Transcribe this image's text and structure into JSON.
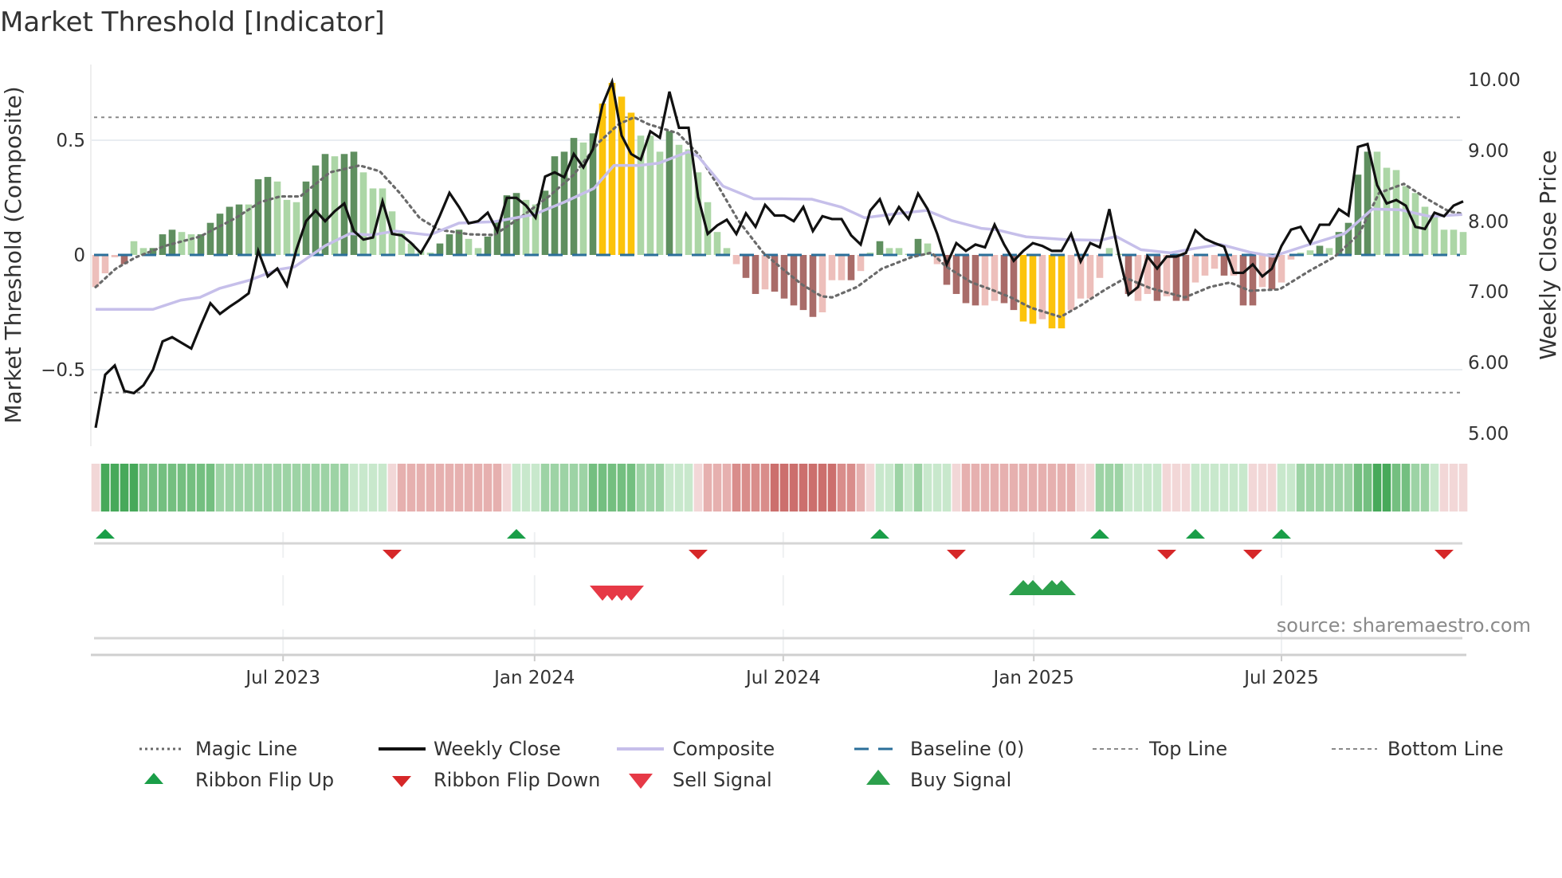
{
  "chart_data": {
    "type": "bar",
    "title": "Market Threshold [Indicator]",
    "ylabel": "Market Threshold (Composite)",
    "ylabel_right": "Weekly Close Price",
    "ylim": [
      -0.83,
      0.83
    ],
    "ylim_right": [
      4.6,
      10.2
    ],
    "yticks": [
      {
        "v": 0.5,
        "label": "0.5"
      },
      {
        "v": 0,
        "label": "0"
      },
      {
        "v": -0.5,
        "label": "−0.5"
      }
    ],
    "yticks_right": [
      {
        "v": 10,
        "label": "10.00"
      },
      {
        "v": 9,
        "label": "9.00"
      },
      {
        "v": 8,
        "label": "8.00"
      },
      {
        "v": 7,
        "label": "7.00"
      },
      {
        "v": 6,
        "label": "6.00"
      },
      {
        "v": 5,
        "label": "5.00"
      }
    ],
    "x_unit": "week index (weekly, ~Feb 2023 to Nov 2025)",
    "xticks": [
      {
        "week": 19.6,
        "label": "Jul 2023"
      },
      {
        "week": 45.9,
        "label": "Jan 2024"
      },
      {
        "week": 71.9,
        "label": "Jul 2024"
      },
      {
        "week": 98.1,
        "label": "Jan 2025"
      },
      {
        "week": 124.0,
        "label": "Jul 2025"
      }
    ],
    "top_line": 0.6,
    "bottom_line": -0.6,
    "baseline": 0,
    "grid": true,
    "legend_placement": "bottom",
    "source": "source: sharemaestro.com",
    "bar_values": [
      -0.14,
      -0.08,
      -0.01,
      -0.04,
      0.06,
      0.03,
      0.03,
      0.09,
      0.11,
      0.1,
      0.09,
      0.09,
      0.14,
      0.18,
      0.21,
      0.22,
      0.22,
      0.33,
      0.34,
      0.32,
      0.24,
      0.23,
      0.32,
      0.39,
      0.44,
      0.43,
      0.44,
      0.45,
      0.36,
      0.29,
      0.29,
      0.19,
      0.1,
      0.05,
      0.02,
      0.01,
      0.05,
      0.09,
      0.11,
      0.07,
      0.03,
      0.08,
      0.15,
      0.26,
      0.27,
      0.24,
      0.22,
      0.28,
      0.43,
      0.45,
      0.51,
      0.49,
      0.53,
      0.66,
      0.75,
      0.69,
      0.62,
      0.52,
      0.52,
      0.45,
      0.54,
      0.48,
      0.46,
      0.36,
      0.23,
      0.1,
      0.03,
      -0.04,
      -0.1,
      -0.17,
      -0.15,
      -0.16,
      -0.19,
      -0.22,
      -0.24,
      -0.27,
      -0.25,
      -0.11,
      -0.11,
      -0.11,
      -0.07,
      0.01,
      0.06,
      0.03,
      0.03,
      0.005,
      0.07,
      0.05,
      -0.04,
      -0.13,
      -0.17,
      -0.21,
      -0.22,
      -0.22,
      -0.2,
      -0.21,
      -0.24,
      -0.29,
      -0.3,
      -0.28,
      -0.32,
      -0.32,
      -0.24,
      -0.19,
      -0.19,
      -0.1,
      0.03,
      0.005,
      -0.17,
      -0.2,
      -0.17,
      -0.2,
      -0.18,
      -0.2,
      -0.2,
      -0.12,
      -0.09,
      -0.06,
      -0.09,
      -0.09,
      -0.22,
      -0.22,
      -0.14,
      -0.15,
      -0.12,
      -0.02,
      0.01,
      0.02,
      0.04,
      0.03,
      0.1,
      0.14,
      0.35,
      0.45,
      0.45,
      0.38,
      0.37,
      0.3,
      0.27,
      0.21,
      0.17,
      0.11,
      0.11,
      0.1
    ],
    "bar_classes": "PPPBLLDDDLLDDDDDLDDLLLDDDLDDLLLLLLLLDDDLLDDDDLLDDDDLDYYYYLLLDLLLLLLPBBPBBBBBPPPBPLDLLLDLPBBBBPPBBYYPYYPPPPLLBPPBPBBPPPBPBBPBPPLLDLDDDDLLLLLLLLLL",
    "bar_class_colors": {
      "D": "#5f8f5f",
      "L": "#acd6a6",
      "Y": "#fcc30b",
      "B": "#a96c69",
      "P": "#edbfbb"
    },
    "weekly_close": [
      5.08,
      5.83,
      5.96,
      5.6,
      5.57,
      5.68,
      5.9,
      6.3,
      6.36,
      6.28,
      6.2,
      6.53,
      6.84,
      6.69,
      6.79,
      6.88,
      6.98,
      7.58,
      7.22,
      7.33,
      7.09,
      7.6,
      8.0,
      8.15,
      8.0,
      8.14,
      8.25,
      7.86,
      7.74,
      7.77,
      8.28,
      7.82,
      7.8,
      7.69,
      7.55,
      7.78,
      8.08,
      8.4,
      8.2,
      7.97,
      8.0,
      8.12,
      7.86,
      8.33,
      8.33,
      8.22,
      8.05,
      8.63,
      8.69,
      8.62,
      8.95,
      8.76,
      9.02,
      9.64,
      9.97,
      9.21,
      8.95,
      8.87,
      9.27,
      9.18,
      9.83,
      9.32,
      9.32,
      8.34,
      7.82,
      7.94,
      8.02,
      7.82,
      8.11,
      7.92,
      8.23,
      8.08,
      8.08,
      8.0,
      8.2,
      7.86,
      8.07,
      8.03,
      8.03,
      7.8,
      7.67,
      8.15,
      8.31,
      7.97,
      8.2,
      8.03,
      8.39,
      8.17,
      7.82,
      7.39,
      7.69,
      7.58,
      7.67,
      7.63,
      7.95,
      7.67,
      7.44,
      7.58,
      7.69,
      7.65,
      7.58,
      7.58,
      7.82,
      7.43,
      7.69,
      7.63,
      8.17,
      7.52,
      6.96,
      7.07,
      7.5,
      7.33,
      7.5,
      7.5,
      7.55,
      7.87,
      7.75,
      7.69,
      7.64,
      7.27,
      7.27,
      7.39,
      7.22,
      7.33,
      7.65,
      7.88,
      7.92,
      7.69,
      7.95,
      7.95,
      8.17,
      8.08,
      9.05,
      9.09,
      8.51,
      8.25,
      8.3,
      8.22,
      7.92,
      7.89,
      8.12,
      8.07,
      8.22,
      8.28
    ],
    "composite_line": [
      [
        0,
        -0.237
      ],
      [
        6,
        -0.237
      ],
      [
        8.9,
        -0.197
      ],
      [
        10.9,
        -0.185
      ],
      [
        13,
        -0.145
      ],
      [
        16.1,
        -0.11
      ],
      [
        19,
        -0.064
      ],
      [
        20.8,
        -0.052
      ],
      [
        24,
        0.04
      ],
      [
        26.6,
        0.093
      ],
      [
        28.9,
        0.087
      ],
      [
        31.3,
        0.104
      ],
      [
        34.9,
        0.087
      ],
      [
        38,
        0.139
      ],
      [
        41.7,
        0.145
      ],
      [
        45.8,
        0.176
      ],
      [
        49,
        0.23
      ],
      [
        52.1,
        0.29
      ],
      [
        54.2,
        0.39
      ],
      [
        56.8,
        0.39
      ],
      [
        58.9,
        0.4
      ],
      [
        62,
        0.45
      ],
      [
        63,
        0.43
      ],
      [
        65.6,
        0.3
      ],
      [
        68.8,
        0.245
      ],
      [
        71.8,
        0.245
      ],
      [
        74.9,
        0.243
      ],
      [
        78,
        0.208
      ],
      [
        80.4,
        0.162
      ],
      [
        83.8,
        0.18
      ],
      [
        86.9,
        0.194
      ],
      [
        89.5,
        0.15
      ],
      [
        92.6,
        0.116
      ],
      [
        94.2,
        0.11
      ],
      [
        97.3,
        0.079
      ],
      [
        101.5,
        0.067
      ],
      [
        105.1,
        0.064
      ],
      [
        106.7,
        0.081
      ],
      [
        109.3,
        0.023
      ],
      [
        112.4,
        0.009
      ],
      [
        115,
        0.029
      ],
      [
        117.6,
        0.046
      ],
      [
        120.7,
        0.012
      ],
      [
        123.1,
        -0.006
      ],
      [
        126.5,
        0.04
      ],
      [
        130.6,
        0.093
      ],
      [
        133.5,
        0.2
      ],
      [
        136.4,
        0.197
      ],
      [
        139.5,
        0.168
      ],
      [
        142.9,
        0.176
      ]
    ],
    "magic_line": [
      [
        0,
        -0.14
      ],
      [
        2.1,
        -0.06
      ],
      [
        4.2,
        -0.01
      ],
      [
        7.3,
        0.04
      ],
      [
        10.9,
        0.08
      ],
      [
        14.6,
        0.16
      ],
      [
        17.2,
        0.23
      ],
      [
        19.3,
        0.255
      ],
      [
        21.4,
        0.255
      ],
      [
        24.5,
        0.36
      ],
      [
        27.6,
        0.39
      ],
      [
        29.7,
        0.365
      ],
      [
        31.8,
        0.27
      ],
      [
        33.9,
        0.16
      ],
      [
        35.9,
        0.11
      ],
      [
        39.1,
        0.09
      ],
      [
        41.7,
        0.087
      ],
      [
        44.3,
        0.16
      ],
      [
        47.4,
        0.255
      ],
      [
        50,
        0.35
      ],
      [
        52.6,
        0.49
      ],
      [
        54.7,
        0.57
      ],
      [
        56.3,
        0.6
      ],
      [
        57.8,
        0.57
      ],
      [
        60.9,
        0.53
      ],
      [
        63,
        0.44
      ],
      [
        65.1,
        0.3
      ],
      [
        67.2,
        0.15
      ],
      [
        69.8,
        0.01
      ],
      [
        71.8,
        -0.06
      ],
      [
        73.9,
        -0.13
      ],
      [
        75.9,
        -0.18
      ],
      [
        77,
        -0.185
      ],
      [
        79.6,
        -0.14
      ],
      [
        82.2,
        -0.06
      ],
      [
        85.3,
        -0.01
      ],
      [
        87.4,
        0.01
      ],
      [
        88.9,
        -0.05
      ],
      [
        91.6,
        -0.12
      ],
      [
        93.6,
        -0.15
      ],
      [
        95.7,
        -0.185
      ],
      [
        97.8,
        -0.23
      ],
      [
        100.9,
        -0.27
      ],
      [
        103,
        -0.22
      ],
      [
        105.6,
        -0.15
      ],
      [
        107.7,
        -0.1
      ],
      [
        110.3,
        -0.145
      ],
      [
        113.9,
        -0.185
      ],
      [
        116.5,
        -0.14
      ],
      [
        118.6,
        -0.12
      ],
      [
        120.7,
        -0.156
      ],
      [
        123.8,
        -0.15
      ],
      [
        126.9,
        -0.07
      ],
      [
        129.5,
        -0.01
      ],
      [
        132.1,
        0.09
      ],
      [
        134.2,
        0.27
      ],
      [
        136.8,
        0.31
      ],
      [
        139.4,
        0.24
      ],
      [
        141.5,
        0.19
      ],
      [
        142.9,
        0.18
      ]
    ],
    "ribbon_levels": [
      -1,
      4,
      4,
      4,
      4,
      3,
      3,
      3,
      3,
      3,
      3,
      3,
      3,
      2,
      2,
      2,
      2,
      2,
      2,
      2,
      2,
      2,
      2,
      2,
      2,
      2,
      2,
      1,
      1,
      1,
      1,
      -1,
      -2,
      -2,
      -2,
      -2,
      -2,
      -2,
      -2,
      -2,
      -2,
      -2,
      -2,
      -1,
      1,
      1,
      1,
      2,
      2,
      2,
      2,
      2,
      3,
      3,
      3,
      3,
      3,
      2,
      2,
      2,
      1,
      1,
      1,
      -1,
      -2,
      -2,
      -2,
      -3,
      -3,
      -3,
      -3,
      -4,
      -4,
      -4,
      -4,
      -4,
      -4,
      -4,
      -3,
      -3,
      -2,
      -1,
      1,
      1,
      2,
      1,
      2,
      1,
      1,
      1,
      -1,
      -2,
      -2,
      -2,
      -2,
      -2,
      -2,
      -2,
      -2,
      -2,
      -2,
      -2,
      -2,
      -1,
      -1,
      2,
      2,
      2,
      1,
      1,
      1,
      1,
      -1,
      -1,
      -1,
      1,
      1,
      1,
      1,
      1,
      1,
      -1,
      -1,
      -1,
      1,
      1,
      2,
      2,
      2,
      2,
      2,
      2,
      3,
      3,
      4,
      4,
      3,
      3,
      2,
      2,
      1,
      -1,
      -1,
      -1
    ],
    "ribbon_colors": {
      "4": "#47a95a",
      "3": "#74bf80",
      "2": "#9dd3a5",
      "1": "#c8e8cc",
      "-1": "#f2d7d7",
      "-2": "#e6b0af",
      "-3": "#d98d8b",
      "-4": "#cc6f6d"
    },
    "ribbon_flip_up": [
      1,
      44,
      82,
      105,
      115,
      124
    ],
    "ribbon_flip_down": [
      31,
      63,
      90,
      112,
      121,
      141
    ],
    "sell_signals": [
      53,
      54,
      55,
      56
    ],
    "buy_signals": [
      97,
      98,
      100,
      101
    ],
    "colors": {
      "weekly_close": "#111111",
      "composite": "#c6bfea",
      "magic": "#6a6a6a",
      "baseline": "#2b6f9a",
      "threshold": "#8a8a8a",
      "flip_up": "#1a9e48",
      "flip_down": "#d62728",
      "sell": "#e63946",
      "buy": "#2ca04c"
    },
    "legend": [
      "Magic Line",
      "Weekly Close",
      "Composite",
      "Baseline (0)",
      "Top Line",
      "Bottom Line",
      "Ribbon Flip Up",
      "Ribbon Flip Down",
      "Sell Signal",
      "Buy Signal"
    ]
  }
}
